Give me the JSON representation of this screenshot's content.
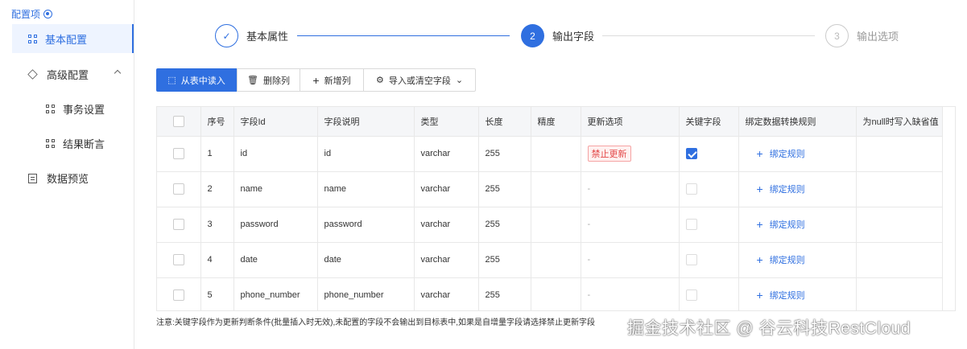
{
  "sidebar": {
    "title": "配置项",
    "items": [
      {
        "label": "基本配置",
        "active": true
      },
      {
        "label": "高级配置"
      },
      {
        "label": "事务设置"
      },
      {
        "label": "结果断言"
      },
      {
        "label": "数据预览"
      }
    ]
  },
  "steps": [
    {
      "number": "✓",
      "label": "基本属性",
      "state": "done"
    },
    {
      "number": "2",
      "label": "输出字段",
      "state": "active"
    },
    {
      "number": "3",
      "label": "输出选项",
      "state": "pending"
    }
  ],
  "toolbar": {
    "read_from_table": "从表中读入",
    "delete_column": "删除列",
    "add_column": "新增列",
    "import_or_clear": "导入或清空字段"
  },
  "table": {
    "headers": [
      "序号",
      "字段Id",
      "字段说明",
      "类型",
      "长度",
      "精度",
      "更新选项",
      "关键字段",
      "绑定数据转换规则",
      "为null时写入缺省值"
    ],
    "rows": [
      {
        "index": "1",
        "field_id": "id",
        "description": "id",
        "type": "varchar",
        "length": "255",
        "precision": "",
        "update_option": "禁止更新",
        "key": true,
        "bind": "绑定规则"
      },
      {
        "index": "2",
        "field_id": "name",
        "description": "name",
        "type": "varchar",
        "length": "255",
        "precision": "",
        "update_option": "-",
        "key": false,
        "bind": "绑定规则"
      },
      {
        "index": "3",
        "field_id": "password",
        "description": "password",
        "type": "varchar",
        "length": "255",
        "precision": "",
        "update_option": "-",
        "key": false,
        "bind": "绑定规则"
      },
      {
        "index": "4",
        "field_id": "date",
        "description": "date",
        "type": "varchar",
        "length": "255",
        "precision": "",
        "update_option": "-",
        "key": false,
        "bind": "绑定规则"
      },
      {
        "index": "5",
        "field_id": "phone_number",
        "description": "phone_number",
        "type": "varchar",
        "length": "255",
        "precision": "",
        "update_option": "-",
        "key": false,
        "bind": "绑定规则"
      }
    ]
  },
  "note": "注意:关键字段作为更新判断条件(批量插入时无效),未配置的字段不会输出到目标表中,如果是自增量字段请选择禁止更新字段",
  "watermark": "掘金技术社区 @ 谷云科技RestCloud",
  "colors": {
    "accent": "#2f6fe0",
    "danger": "#e34a4a"
  }
}
